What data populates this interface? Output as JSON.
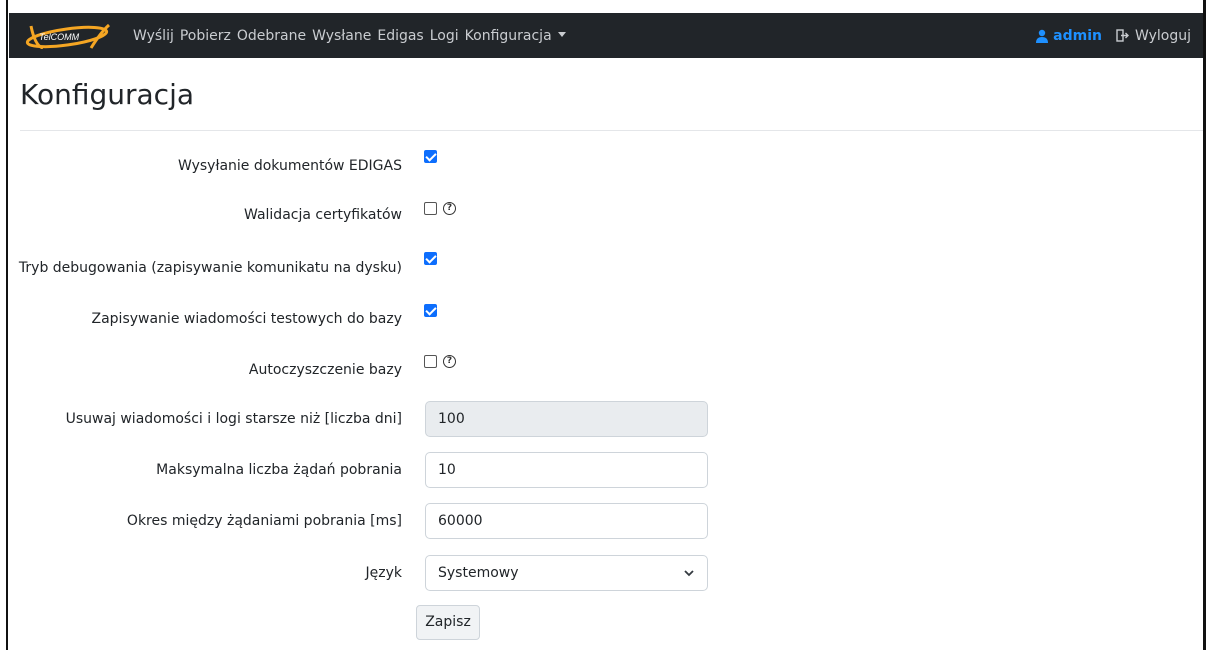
{
  "nav": {
    "brand": "TelCOMM",
    "links": [
      "Wyślij",
      "Pobierz",
      "Odebrane",
      "Wysłane",
      "Edigas",
      "Logi"
    ],
    "dropdown": "Konfiguracja",
    "user": "admin",
    "logout": "Wyloguj",
    "user_color": "#1e90ff",
    "brand_accent": "#f5a623"
  },
  "page": {
    "title": "Konfiguracja"
  },
  "form": {
    "edigas_label": "Wysyłanie dokumentów EDIGAS",
    "edigas_checked": true,
    "cert_label": "Walidacja certyfikatów",
    "cert_checked": false,
    "debug_label": "Tryb debugowania (zapisywanie komunikatu na dysku)",
    "debug_checked": true,
    "test_label": "Zapisywanie wiadomości testowych do bazy",
    "test_checked": true,
    "autoclean_label": "Autoczyszczenie bazy",
    "autoclean_checked": false,
    "days_label": "Usuwaj wiadomości i logi starsze niż [liczba dni]",
    "days_value": "100",
    "max_label": "Maksymalna liczba żądań pobrania",
    "max_value": "10",
    "period_label": "Okres między żądaniami pobrania [ms]",
    "period_value": "60000",
    "lang_label": "Język",
    "lang_value": "Systemowy",
    "save": "Zapisz",
    "help_glyph": "?"
  }
}
